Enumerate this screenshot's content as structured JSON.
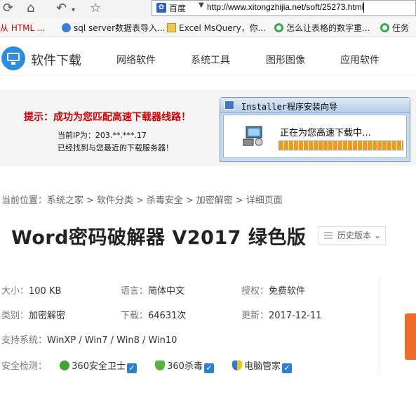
{
  "browser": {
    "search_engine": "百度",
    "url": "http://www.xitongzhijia.net/soft/25273.html"
  },
  "bookmarks": [
    {
      "label": "从 HTML ..."
    },
    {
      "label": "sql server数据表导入..."
    },
    {
      "label": "Excel MsQuery，你..."
    },
    {
      "label": "怎么让表格的数字重..."
    },
    {
      "label": "任务"
    }
  ],
  "site": {
    "logo_text": "软件下载",
    "nav": [
      "网络软件",
      "系统工具",
      "图形图像",
      "应用软件"
    ]
  },
  "banner": {
    "tip": "提示：成功为您匹配高速下载器线路！",
    "ip_line": "当前IP为：203.**.***.17",
    "found_line": "已经找到与您最近的下载服务器！",
    "dialog_title": "Installer程序安装向导",
    "dialog_message": "正在为您高速下载中…",
    "progress_percent": 100
  },
  "breadcrumb": [
    "当前位置：系统之家",
    "软件分类",
    "杀毒安全",
    "加密解密",
    "详细页面"
  ],
  "page_title": "Word密码破解器 V2017 绿色版",
  "history_button": "历史版本",
  "info": {
    "size_label": "大小：",
    "size": "100 KB",
    "language_label": "语言：",
    "language": "简体中文",
    "license_label": "授权：",
    "license": "免费软件",
    "category_label": "类别：",
    "category": "加密解密",
    "downloads_label": "下载：",
    "downloads": "64631次",
    "updated_label": "更新：",
    "updated": "2017-12-11",
    "os_label": "支持系统：",
    "os": "WinXP / Win7 / Win8 / Win10",
    "security_label": "安全检测：",
    "security": [
      "360安全卫士",
      "360杀毒",
      "电脑管家"
    ]
  },
  "colors": {
    "accent": "#2a8ee0",
    "tip_red": "#d40000",
    "progress": "#f29a1a",
    "side_tab": "#f06a28"
  }
}
